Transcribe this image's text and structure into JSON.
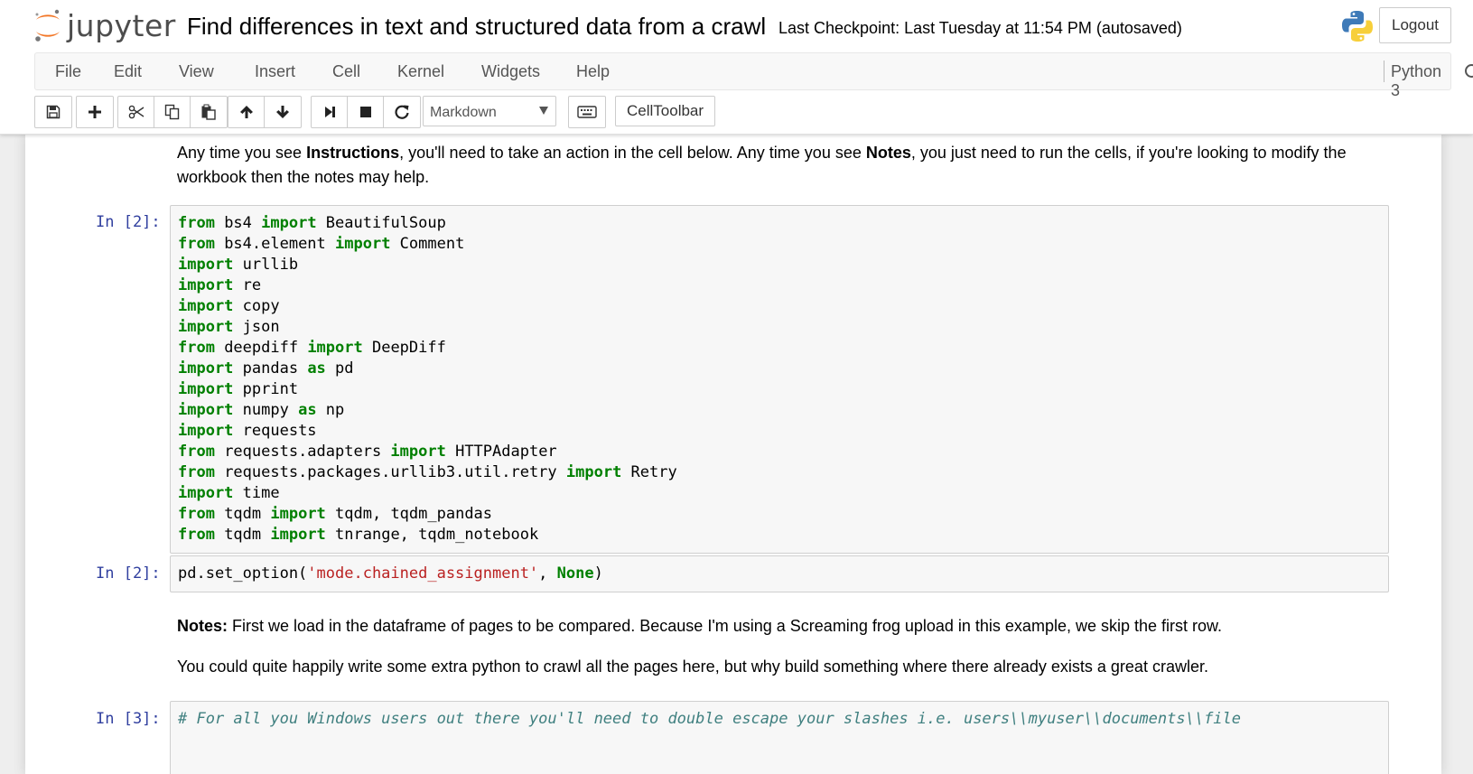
{
  "header": {
    "logo_text": "jupyter",
    "notebook_title": "Find differences in text and structured data from a crawl",
    "checkpoint": "Last Checkpoint: Last Tuesday at 11:54 PM (autosaved)",
    "logout_label": "Logout"
  },
  "menu": {
    "items": [
      "File",
      "Edit",
      "View",
      "Insert",
      "Cell",
      "Kernel",
      "Widgets",
      "Help"
    ],
    "kernel_name": "Python 3"
  },
  "toolbar": {
    "cell_type": "Markdown",
    "celltoolbar_label": "CellToolbar",
    "icons": [
      "save-icon",
      "plus-icon",
      "scissors-icon",
      "copy-icon",
      "paste-icon",
      "arrow-up-icon",
      "arrow-down-icon",
      "step-forward-icon",
      "stop-icon",
      "restart-icon",
      "keyboard-icon"
    ]
  },
  "cells": {
    "md1": {
      "t1": "Any time you see ",
      "b1": "Instructions",
      "t2": ", you'll need to take an action in the cell below. Any time you see ",
      "b2": "Notes",
      "t3": ", you just need to run the cells, if you're looking to modify the workbook then the notes may help."
    },
    "code1": {
      "prompt": "In [2]:",
      "lines": [
        [
          {
            "t": "from",
            "k": "kw"
          },
          {
            "t": " bs4 "
          },
          {
            "t": "import",
            "k": "kw"
          },
          {
            "t": " BeautifulSoup"
          }
        ],
        [
          {
            "t": "from",
            "k": "kw"
          },
          {
            "t": " bs4.element "
          },
          {
            "t": "import",
            "k": "kw"
          },
          {
            "t": " Comment"
          }
        ],
        [
          {
            "t": "import",
            "k": "kw"
          },
          {
            "t": " urllib"
          }
        ],
        [
          {
            "t": "import",
            "k": "kw"
          },
          {
            "t": " re"
          }
        ],
        [
          {
            "t": "import",
            "k": "kw"
          },
          {
            "t": " copy"
          }
        ],
        [
          {
            "t": "import",
            "k": "kw"
          },
          {
            "t": " json"
          }
        ],
        [
          {
            "t": "from",
            "k": "kw"
          },
          {
            "t": " deepdiff "
          },
          {
            "t": "import",
            "k": "kw"
          },
          {
            "t": " DeepDiff"
          }
        ],
        [
          {
            "t": "import",
            "k": "kw"
          },
          {
            "t": " pandas "
          },
          {
            "t": "as",
            "k": "kw"
          },
          {
            "t": " pd"
          }
        ],
        [
          {
            "t": "import",
            "k": "kw"
          },
          {
            "t": " pprint"
          }
        ],
        [
          {
            "t": "import",
            "k": "kw"
          },
          {
            "t": " numpy "
          },
          {
            "t": "as",
            "k": "kw"
          },
          {
            "t": " np"
          }
        ],
        [
          {
            "t": "import",
            "k": "kw"
          },
          {
            "t": " requests"
          }
        ],
        [
          {
            "t": "from",
            "k": "kw"
          },
          {
            "t": " requests.adapters "
          },
          {
            "t": "import",
            "k": "kw"
          },
          {
            "t": " HTTPAdapter"
          }
        ],
        [
          {
            "t": "from",
            "k": "kw"
          },
          {
            "t": " requests.packages.urllib3.util.retry "
          },
          {
            "t": "import",
            "k": "kw"
          },
          {
            "t": " Retry"
          }
        ],
        [
          {
            "t": "import",
            "k": "kw"
          },
          {
            "t": " time"
          }
        ],
        [
          {
            "t": "from",
            "k": "kw"
          },
          {
            "t": " tqdm "
          },
          {
            "t": "import",
            "k": "kw"
          },
          {
            "t": " tqdm, tqdm_pandas"
          }
        ],
        [
          {
            "t": "from",
            "k": "kw"
          },
          {
            "t": " tqdm "
          },
          {
            "t": "import",
            "k": "kw"
          },
          {
            "t": " tnrange, tqdm_notebook"
          }
        ]
      ]
    },
    "code2": {
      "prompt": "In [2]:",
      "lines": [
        [
          {
            "t": "pd.set_option("
          },
          {
            "t": "'mode.chained_assignment'",
            "k": "str"
          },
          {
            "t": ", "
          },
          {
            "t": "None",
            "k": "kw"
          },
          {
            "t": ")"
          }
        ]
      ]
    },
    "md2": {
      "b1": "Notes:",
      "t1": " First we load in the dataframe of pages to be compared. Because I'm using a Screaming frog upload in this example, we skip the first row."
    },
    "md3": {
      "t1": "You could quite happily write some extra python to crawl all the pages here, but why build something where there already exists a great crawler."
    },
    "code3": {
      "prompt": "In [3]:",
      "lines": [
        [
          {
            "t": "# For all you Windows users out there you'll need to double escape your slashes i.e. users\\\\myuser\\\\documents\\\\file",
            "k": "cm"
          }
        ]
      ]
    }
  }
}
